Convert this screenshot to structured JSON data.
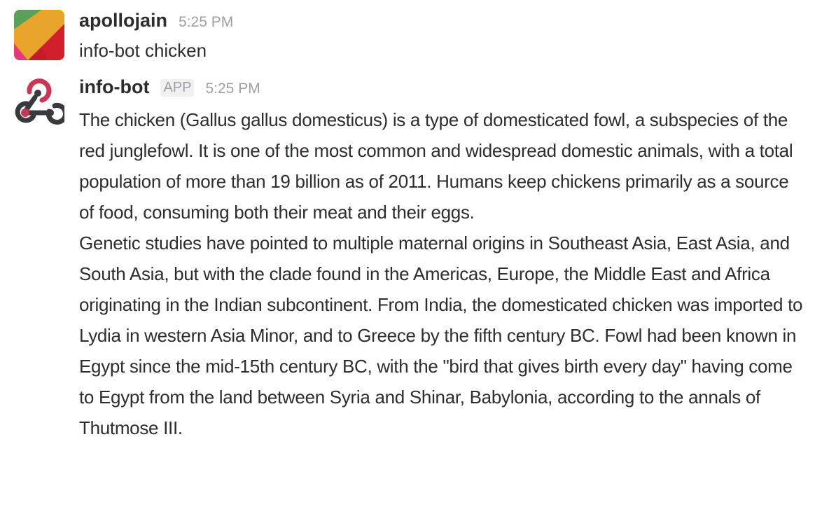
{
  "messages": [
    {
      "author": "apollojain",
      "timestamp": "5:25 PM",
      "text": "info-bot chicken"
    },
    {
      "author": "info-bot",
      "badge": "APP",
      "timestamp": "5:25 PM",
      "paragraphs": [
        "The chicken (Gallus gallus domesticus) is a type of domesticated fowl, a subspecies of the red junglefowl. It is one of the most common and widespread domestic animals, with a total population of more than 19 billion as of 2011. Humans keep chickens primarily as a source of food, consuming both their meat and their eggs.",
        "Genetic studies have pointed to multiple maternal origins in Southeast Asia, East Asia, and South Asia, but with the clade found in the Americas, Europe, the Middle East and Africa originating in the Indian subcontinent. From India, the domesticated chicken was imported to Lydia in western Asia Minor, and to Greece by the fifth century BC. Fowl had been known in Egypt since the mid-15th century BC, with the \"bird that gives birth every day\" having come to Egypt from the land between Syria and Shinar, Babylonia, according to the annals of Thutmose III."
      ]
    }
  ],
  "colors": {
    "author": "#2c2d30",
    "timestamp": "#9e9ea6",
    "webhook_icon": "#3a3a3e",
    "webhook_accent": "#c93756"
  },
  "icons": {
    "user_avatar": "apollojain-avatar",
    "bot_avatar": "webhook-icon"
  }
}
